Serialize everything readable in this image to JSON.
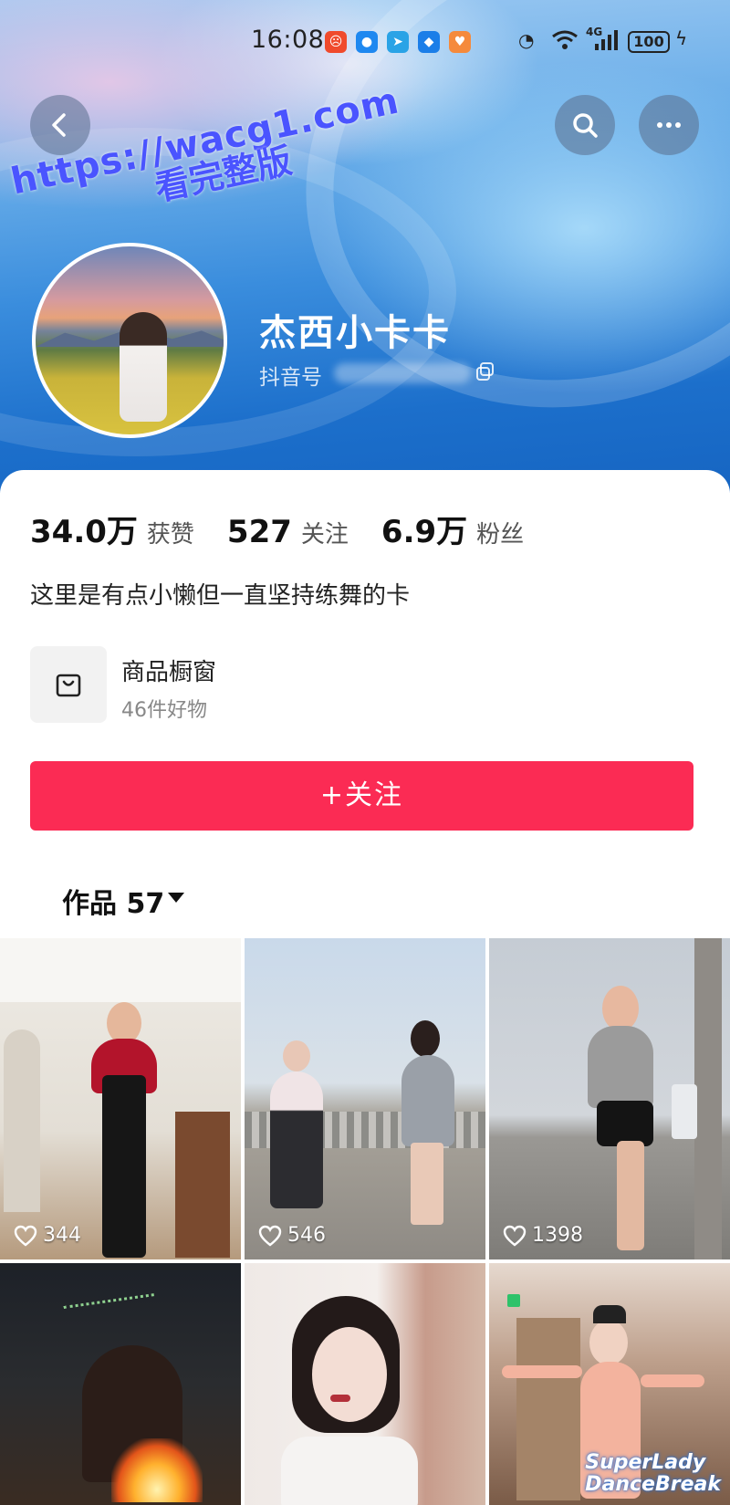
{
  "status_bar": {
    "time": "16:08",
    "network": "4G",
    "battery": "100"
  },
  "watermark": {
    "line1": "https://wacg1.com",
    "line2": "看完整版"
  },
  "profile": {
    "nickname": "杰西小卡卡",
    "douyin_id_label": "抖音号",
    "bio": "这里是有点小懒但一直坚持练舞的卡"
  },
  "stats": [
    {
      "value": "34.0万",
      "label": "获赞"
    },
    {
      "value": "527",
      "label": "关注"
    },
    {
      "value": "6.9万",
      "label": "粉丝"
    }
  ],
  "shop": {
    "title": "商品橱窗",
    "subtitle": "46件好物"
  },
  "follow_button": "+关注",
  "works_tab": "作品 57",
  "videos": [
    {
      "likes": "344"
    },
    {
      "likes": "546"
    },
    {
      "likes": "1398"
    },
    {
      "likes": ""
    },
    {
      "likes": ""
    },
    {
      "likes": "",
      "caption_line1": "SuperLady",
      "caption_line2": "DanceBreak"
    }
  ],
  "colors": {
    "follow": "#fb2b54",
    "header_blue": "#1c6fcb"
  }
}
